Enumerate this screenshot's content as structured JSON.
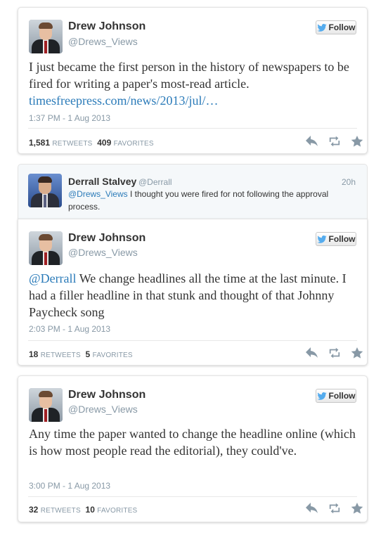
{
  "tweets": [
    {
      "name": "Drew Johnson",
      "handle": "@Drews_Views",
      "follow_label": "Follow",
      "text": "I just became the first person in the history of newspapers to be fired for writing a paper's most-read article.",
      "link": "timesfreepress.com/news/2013/jul/…",
      "time": "1:37 PM - 1 Aug 2013",
      "retweets": "1,581",
      "retweets_label": "RETWEETS",
      "favorites": "409",
      "favorites_label": "FAVORITES"
    },
    {
      "name": "Drew Johnson",
      "handle": "@Drews_Views",
      "follow_label": "Follow",
      "mention": "@Derrall",
      "text": " We change headlines all the time at the last minute. I had a filler headline in that stunk and thought of that Johnny Paycheck song",
      "time": "2:03 PM - 1 Aug 2013",
      "retweets": "18",
      "retweets_label": "RETWEETS",
      "favorites": "5",
      "favorites_label": "FAVORITES"
    },
    {
      "name": "Drew Johnson",
      "handle": "@Drews_Views",
      "follow_label": "Follow",
      "text": "Any time the paper wanted to change the headline online (which is how most people read the editorial), they could've.",
      "time": "3:00 PM - 1 Aug 2013",
      "retweets": "32",
      "retweets_label": "RETWEETS",
      "favorites": "10",
      "favorites_label": "FAVORITES"
    }
  ],
  "in_reply": {
    "name": "Derrall Stalvey",
    "handle": "@Derrall",
    "mention": "@Drews_Views",
    "text": " I thought you were fired for not following the approval process.",
    "ago": "20h"
  },
  "colors": {
    "link": "#2b7bb9",
    "muted": "#8899a6",
    "text": "#333333",
    "twitter_blue": "#55acee"
  },
  "icons": [
    "twitter-bird-icon",
    "reply-icon",
    "retweet-icon",
    "favorite-star-icon"
  ]
}
